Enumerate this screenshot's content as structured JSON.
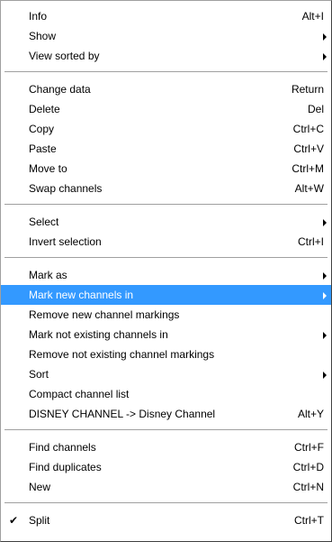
{
  "menu": {
    "sections": [
      [
        {
          "label": "Info",
          "shortcut": "Alt+I"
        },
        {
          "label": "Show",
          "submenu": true
        },
        {
          "label": "View sorted by",
          "submenu": true
        }
      ],
      [
        {
          "label": "Change data",
          "shortcut": "Return"
        },
        {
          "label": "Delete",
          "shortcut": "Del"
        },
        {
          "label": "Copy",
          "shortcut": "Ctrl+C"
        },
        {
          "label": "Paste",
          "shortcut": "Ctrl+V"
        },
        {
          "label": "Move to",
          "shortcut": "Ctrl+M"
        },
        {
          "label": "Swap channels",
          "shortcut": "Alt+W"
        }
      ],
      [
        {
          "label": "Select",
          "submenu": true
        },
        {
          "label": "Invert selection",
          "shortcut": "Ctrl+I"
        }
      ],
      [
        {
          "label": "Mark as",
          "submenu": true
        },
        {
          "label": "Mark new channels in",
          "submenu": true,
          "highlighted": true
        },
        {
          "label": "Remove new channel markings"
        },
        {
          "label": "Mark not existing channels in",
          "submenu": true
        },
        {
          "label": "Remove not existing channel markings"
        },
        {
          "label": "Sort",
          "submenu": true
        },
        {
          "label": "Compact channel list"
        },
        {
          "label": "DISNEY CHANNEL -> Disney Channel",
          "shortcut": "Alt+Y"
        }
      ],
      [
        {
          "label": "Find channels",
          "shortcut": "Ctrl+F"
        },
        {
          "label": "Find duplicates",
          "shortcut": "Ctrl+D"
        },
        {
          "label": "New",
          "shortcut": "Ctrl+N"
        }
      ],
      [
        {
          "label": "Split",
          "shortcut": "Ctrl+T",
          "checked": true,
          "check_glyph": "✔"
        }
      ]
    ]
  },
  "colors": {
    "highlight_bg": "#3399ff",
    "highlight_text": "#ffffff",
    "menu_bg": "#ffffff",
    "separator": "#a0a0a0"
  }
}
